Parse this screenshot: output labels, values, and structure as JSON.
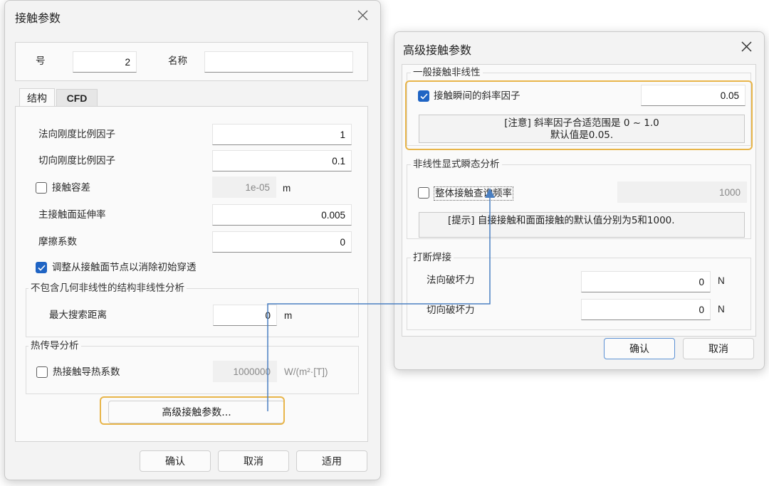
{
  "main_dialog": {
    "title": "接触参数",
    "number_label": "号",
    "number_value": "2",
    "name_label": "名称",
    "name_value": "",
    "tabs": [
      {
        "label": "结构",
        "active": true
      },
      {
        "label": "CFD",
        "active": false
      }
    ],
    "structure": {
      "normal_stiffness_label": "法向刚度比例因子",
      "normal_stiffness_value": "1",
      "tangential_stiffness_label": "切向刚度比例因子",
      "tangential_stiffness_value": "0.1",
      "contact_tolerance_label": "接触容差",
      "contact_tolerance_checked": false,
      "contact_tolerance_value": "1e-05",
      "contact_tolerance_unit": "m",
      "extension_label": "主接触面延伸率",
      "extension_value": "0.005",
      "friction_label": "摩擦系数",
      "friction_value": "0",
      "adjust_nodes_label": "调整从接触面节点以消除初始穿透",
      "adjust_nodes_checked": true
    },
    "nonlinear_group": {
      "title": "不包含几何非线性的结构非线性分析",
      "max_search_label": "最大搜索距离",
      "max_search_value": "0",
      "max_search_unit": "m"
    },
    "heat_group": {
      "title": "热传导分析",
      "coefficient_label": "热接触导热系数",
      "coefficient_checked": false,
      "coefficient_value": "1000000",
      "coefficient_unit": "W/(m²·[T])"
    },
    "advanced_button": "高级接触参数...",
    "buttons": {
      "ok": "确认",
      "cancel": "取消",
      "apply": "适用"
    }
  },
  "advanced_dialog": {
    "title": "高级接触参数",
    "general_group": {
      "title": "一般接触非线性",
      "slope_label": "接触瞬间的斜率因子",
      "slope_checked": true,
      "slope_value": "0.05",
      "note_line1": "[注意] 斜率因子合适范围是 0 ~ 1.0",
      "note_line2": "默认值是0.05."
    },
    "explicit_group": {
      "title": "非线性显式瞬态分析",
      "query_label": "整体接触查询频率",
      "query_checked": false,
      "query_value": "1000",
      "hint": "[提示] 自接接触和面面接触的默认值分别为5和1000."
    },
    "weld_group": {
      "title": "打断焊接",
      "normal_label": "法向破坏力",
      "normal_value": "0",
      "normal_unit": "N",
      "tangential_label": "切向破坏力",
      "tangential_value": "0",
      "tangential_unit": "N"
    },
    "buttons": {
      "ok": "确认",
      "cancel": "取消"
    }
  },
  "colors": {
    "highlight": "#e8b54a",
    "connector": "#4a7fc1",
    "checkbox_checked": "#1f64c4"
  },
  "icons": [
    "close-icon",
    "checkmark-icon",
    "arrow-up-icon"
  ]
}
